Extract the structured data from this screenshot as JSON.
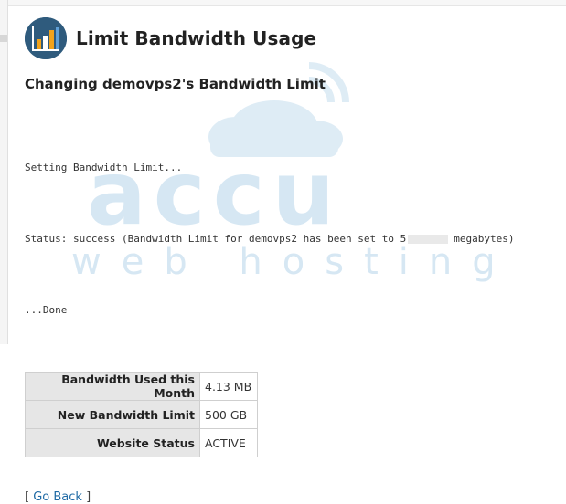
{
  "header": {
    "title": "Limit Bandwidth Usage",
    "icon": "bandwidth-chart-icon"
  },
  "subtitle": "Changing demovps2's Bandwidth Limit",
  "log": {
    "line1": "Setting Bandwidth Limit...",
    "line2_prefix": "Status: success (Bandwidth Limit for demovps2 has been set to 5",
    "line2_suffix": "megabytes)",
    "line3": "...Done"
  },
  "stats": [
    {
      "label": "Bandwidth Used this Month",
      "value": "4.13 MB"
    },
    {
      "label": "New Bandwidth Limit",
      "value": "500 GB"
    },
    {
      "label": "Website Status",
      "value": "ACTIVE"
    }
  ],
  "go_back": {
    "open": "[",
    "label": "Go Back",
    "close": "]"
  },
  "watermark": {
    "brand": "accu",
    "tagline": "web hosting",
    "color": "#cfe3f1"
  }
}
